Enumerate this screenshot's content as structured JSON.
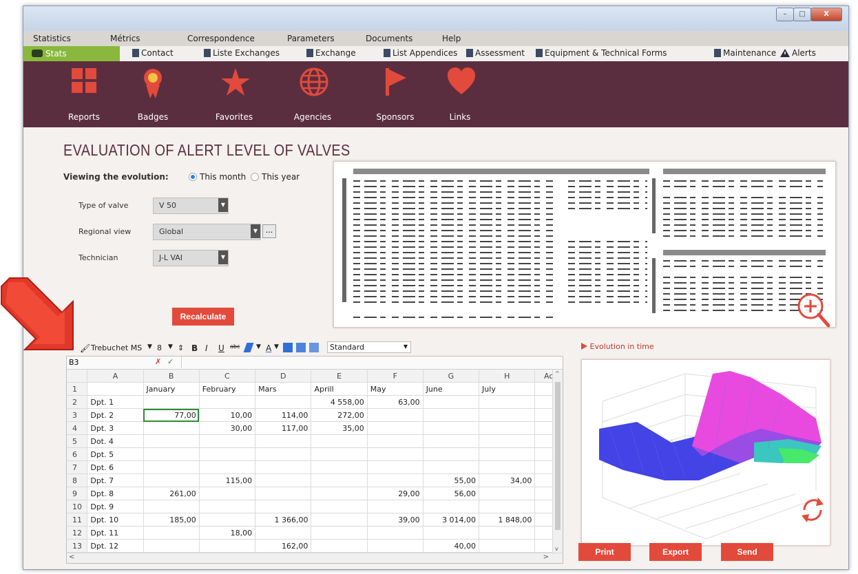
{
  "window": {
    "min": "–",
    "max": "□",
    "close": "X"
  },
  "menu": [
    "Statistics",
    "Métrics",
    "Correspondence",
    "Parameters",
    "Documents",
    "Help"
  ],
  "tabs": {
    "stats": "Stats",
    "items": [
      "Contact",
      "Liste Exchanges",
      "Exchange",
      "List Appendices",
      "Assessment",
      "Equipment & Technical Forms",
      "Maintenance",
      "Alerts"
    ]
  },
  "banner": [
    "Reports",
    "Badges",
    "Favorites",
    "Agencies",
    "Sponsors",
    "Links"
  ],
  "title": "EVALUATION OF ALERT LEVEL OF VALVES",
  "viewing": {
    "label": "Viewing the evolution:",
    "opt1": "This month",
    "opt2": "This year"
  },
  "fields": {
    "type_label": "Type of valve",
    "type_value": "V 50",
    "regional_label": "Regional view",
    "regional_value": "Global",
    "tech_label": "Technician",
    "tech_value": "J-L VAI",
    "ellipsis": "..."
  },
  "recalculate": "Recalculate",
  "sheet_toolbar": {
    "font": "Trebuchet MS",
    "size": "8",
    "bold": "B",
    "italic": "I",
    "underline": "U",
    "strike": "abc",
    "format": "Standard"
  },
  "formula_bar": {
    "cell": "B3"
  },
  "sheet": {
    "cols": [
      "",
      "A",
      "B",
      "C",
      "D",
      "E",
      "F",
      "G",
      "H",
      "Ac"
    ],
    "header_row": [
      "1",
      "",
      "January",
      "February",
      "Mars",
      "Aprill",
      "May",
      "June",
      "July",
      ""
    ],
    "rows": [
      [
        "2",
        "Dpt. 1",
        "",
        "",
        "",
        "4 558,00",
        "63,00",
        "",
        "",
        ""
      ],
      [
        "3",
        "Dpt. 2",
        "77,00",
        "10,00",
        "114,00",
        "272,00",
        "",
        "",
        "",
        ""
      ],
      [
        "4",
        "Dpt. 3",
        "",
        "30,00",
        "117,00",
        "35,00",
        "",
        "",
        "",
        ""
      ],
      [
        "5",
        "Dot. 4",
        "",
        "",
        "",
        "",
        "",
        "",
        "",
        ""
      ],
      [
        "6",
        "Dpt. 5",
        "",
        "",
        "",
        "",
        "",
        "",
        "",
        ""
      ],
      [
        "7",
        "Dpt. 6",
        "",
        "",
        "",
        "",
        "",
        "",
        "",
        ""
      ],
      [
        "8",
        "Dpt. 7",
        "",
        "115,00",
        "",
        "",
        "",
        "55,00",
        "34,00",
        ""
      ],
      [
        "9",
        "Dpt. 8",
        "261,00",
        "",
        "",
        "",
        "29,00",
        "56,00",
        "",
        ""
      ],
      [
        "10",
        "Dpt. 9",
        "",
        "",
        "",
        "",
        "",
        "",
        "",
        ""
      ],
      [
        "11",
        "Dpt. 10",
        "185,00",
        "",
        "1 366,00",
        "",
        "39,00",
        "3 014,00",
        "1 848,00",
        ""
      ],
      [
        "12",
        "Dpt. 11",
        "",
        "18,00",
        "",
        "",
        "",
        "",
        "",
        ""
      ],
      [
        "13",
        "Dpt. 12",
        "",
        "",
        "162,00",
        "",
        "",
        "40,00",
        "",
        ""
      ]
    ]
  },
  "evolution_label": "Evolution in time",
  "actions": {
    "print": "Print",
    "export": "Export",
    "send": "Send"
  },
  "colors": {
    "banner": "#5b2e3f",
    "accent": "#e24a3b",
    "stats_tab": "#8ab83c"
  }
}
